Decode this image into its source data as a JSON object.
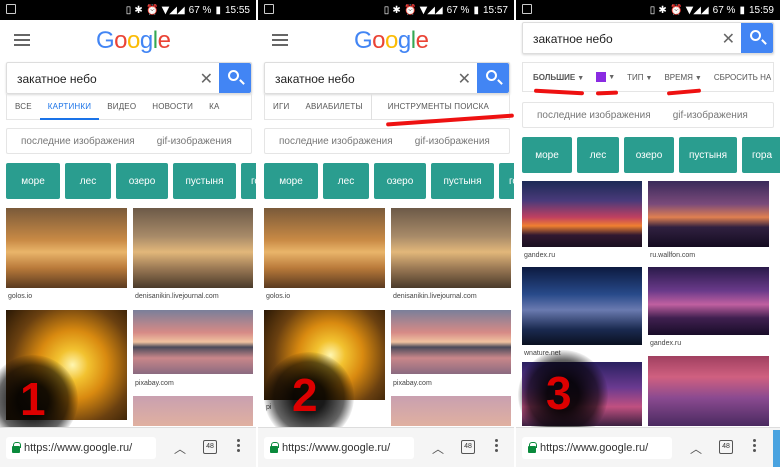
{
  "panels": [
    {
      "status": {
        "battery": "67 %",
        "time": "15:55"
      },
      "logo": "Google",
      "query": "закатное небо",
      "tabs": [
        "ВСЕ",
        "КАРТИНКИ",
        "ВИДЕО",
        "НОВОСТИ",
        "КА"
      ],
      "suggestions": [
        "последние изображения",
        "gif-изображения"
      ],
      "chips": [
        "море",
        "лес",
        "озеро",
        "пустыня",
        "гора"
      ],
      "sources": [
        "golos.io",
        "denisanikin.livejournal.com",
        "pixabay.com"
      ],
      "url": "https://www.google.ru/",
      "tab_count": "48",
      "number": "1"
    },
    {
      "status": {
        "battery": "67 %",
        "time": "15:57"
      },
      "logo": "Google",
      "query": "закатное небо",
      "tabs": [
        "ИГИ",
        "АВИАБИЛЕТЫ",
        "ИНСТРУМЕНТЫ ПОИСКА"
      ],
      "suggestions": [
        "последние изображения",
        "gif-изображения"
      ],
      "chips": [
        "море",
        "лес",
        "озеро",
        "пустыня",
        "гора"
      ],
      "sources": [
        "golos.io",
        "denisanikin.livejournal.com",
        "pixabay.com",
        "pi"
      ],
      "url": "https://www.google.ru/",
      "tab_count": "48",
      "number": "2"
    },
    {
      "status": {
        "battery": "67 %",
        "time": "15:59"
      },
      "query": "закатное небо",
      "filters": [
        "БОЛЬШИЕ",
        "ТИП",
        "ВРЕМЯ",
        "СБРОСИТЬ НА"
      ],
      "color_swatch": "#8a2be2",
      "suggestions": [
        "последние изображения",
        "gif-изображения"
      ],
      "chips": [
        "море",
        "лес",
        "озеро",
        "пустыня",
        "гора"
      ],
      "sources": [
        "gandex.ru",
        "ru.wallfon.com",
        "wnature.net",
        "gandex.ru"
      ],
      "url": "https://www.google.ru/",
      "tab_count": "48",
      "number": "3"
    }
  ],
  "colors": {
    "google_blue": "#4285f4",
    "chip_teal": "#2a9d8f",
    "annotation_red": "#e11"
  }
}
